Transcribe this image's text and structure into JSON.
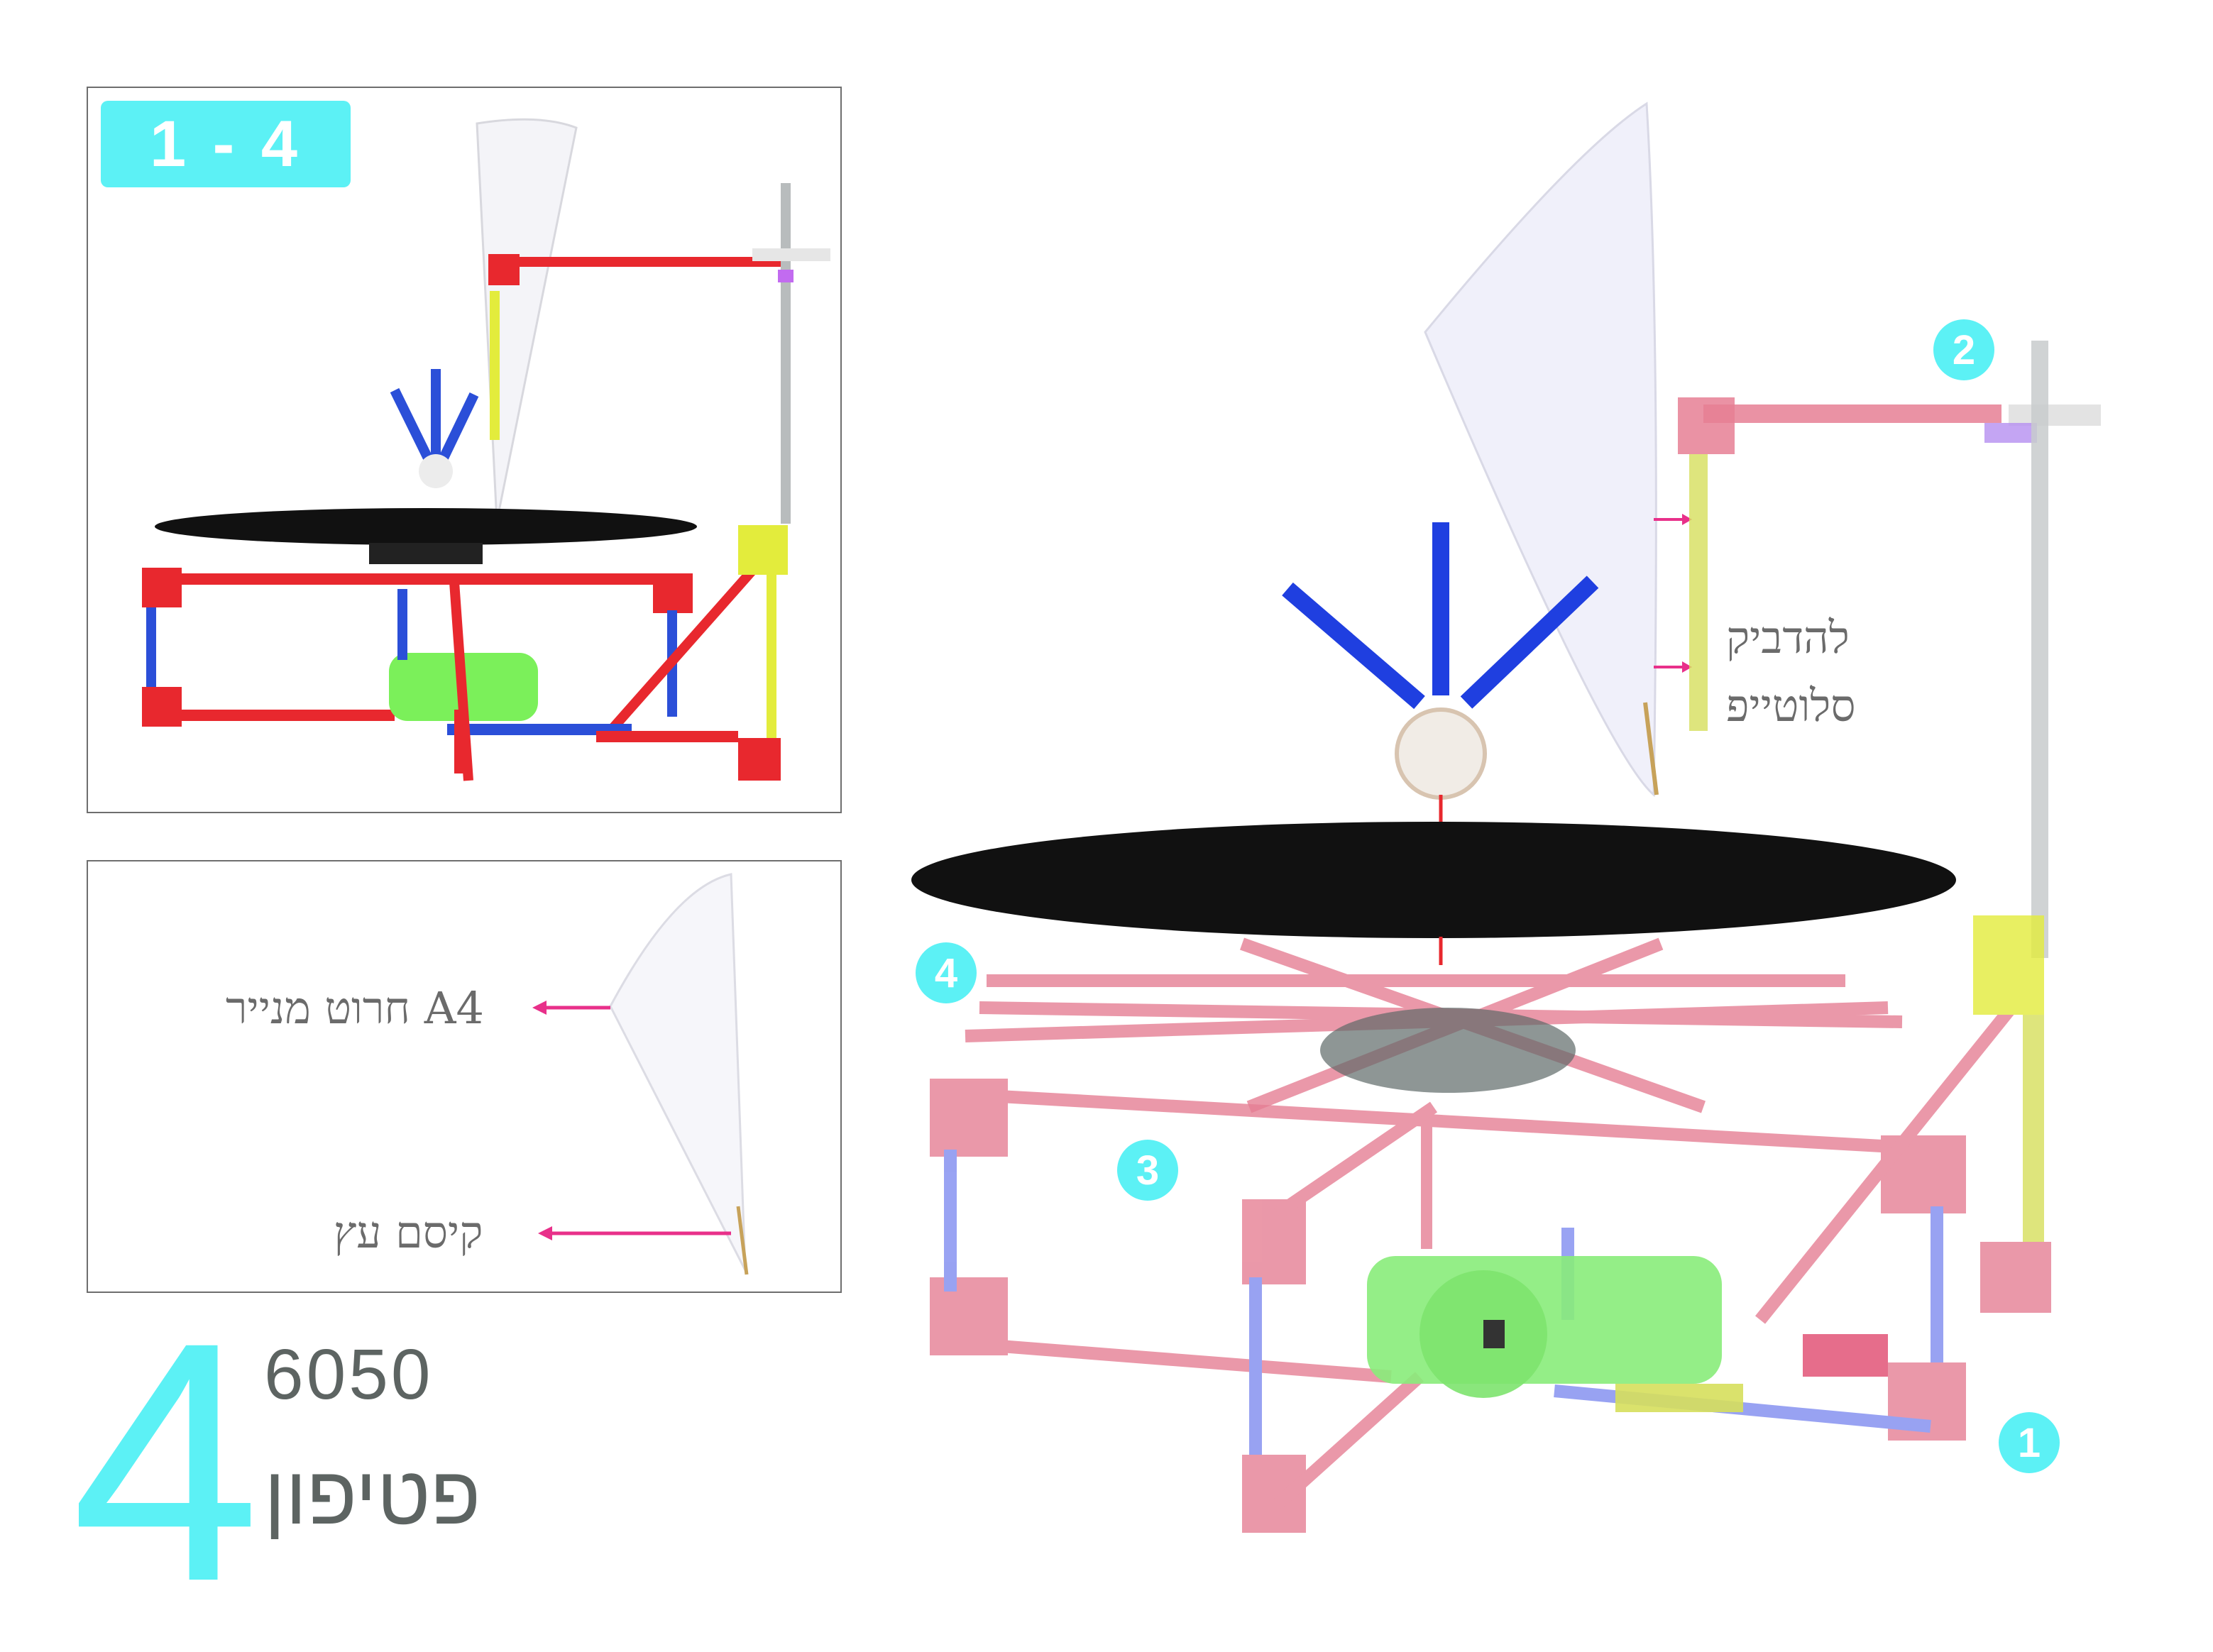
{
  "range_badge": "1 - 4",
  "detail": {
    "cone_label": "חרוט מנייר A4",
    "stick_label": "קיסם עץ"
  },
  "main": {
    "tape_label_line1": "להדביק",
    "tape_label_line2": "סלוטייפ"
  },
  "callouts": [
    "1",
    "2",
    "3",
    "4"
  ],
  "footer": {
    "step_number": "4",
    "model_number": "6050",
    "model_name": "פטיפון"
  },
  "colors": {
    "accent": "#5cf1f5",
    "arrow": "#e8308a",
    "rod_red": "#e8282e",
    "rod_blue": "#2b4fd8",
    "rod_yellow": "#e3ec3c",
    "motor_green": "#7bf05a",
    "disc": "#111111"
  }
}
